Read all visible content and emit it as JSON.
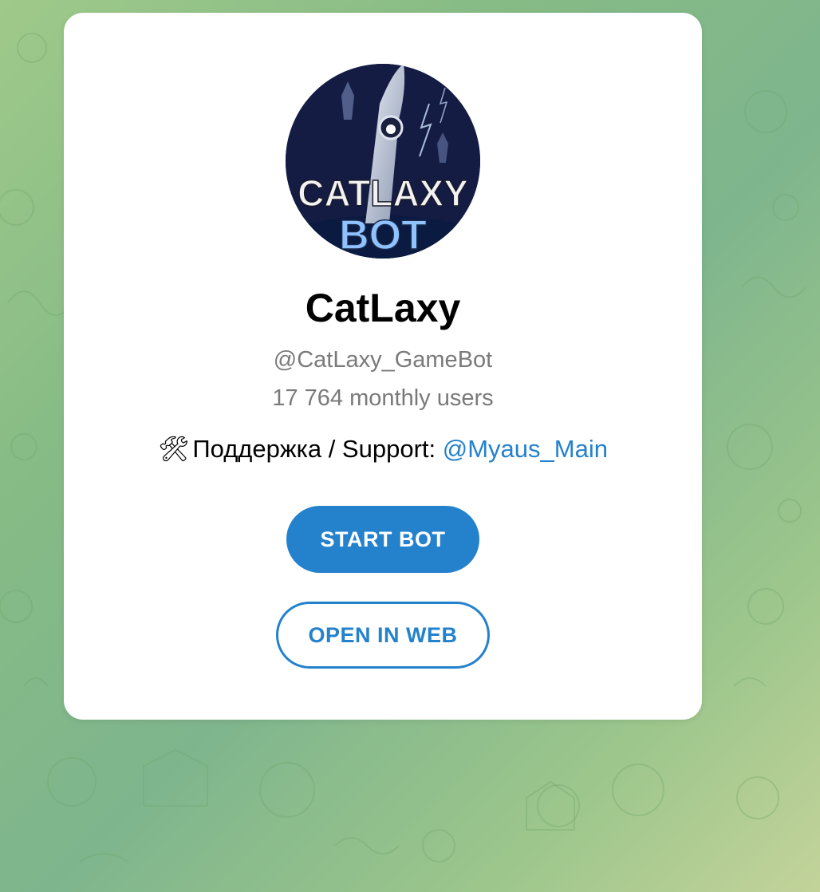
{
  "bot": {
    "name": "CatLaxy",
    "username": "@CatLaxy_GameBot",
    "monthly_users": "17 764 monthly users",
    "description_prefix": "Поддержка / Support: ",
    "description_link": "@Myaus_Main",
    "avatar_text_line1": "CATLAXY",
    "avatar_text_line2": "BOT"
  },
  "buttons": {
    "start": "START BOT",
    "open_web": "OPEN IN WEB"
  },
  "colors": {
    "accent": "#2481cc",
    "secondary_text": "#7a7a7a",
    "background_green": "#86bb86"
  },
  "icons": {
    "description_icon": "hammer-and-wrench-icon"
  }
}
